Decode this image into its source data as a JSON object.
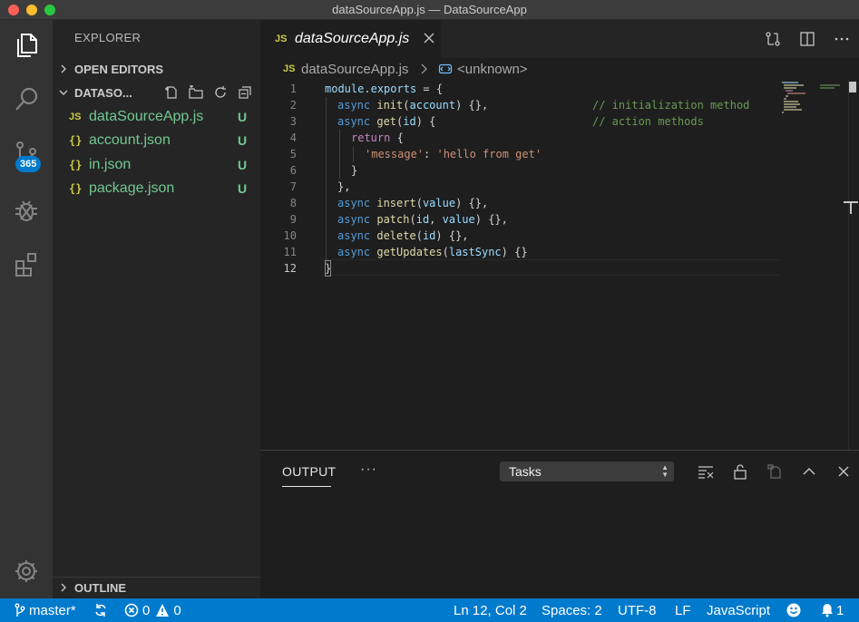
{
  "window": {
    "title": "dataSourceApp.js — DataSourceApp"
  },
  "activity_bar": {
    "items": [
      {
        "name": "explorer",
        "icon": "files-icon"
      },
      {
        "name": "search",
        "icon": "search-icon"
      },
      {
        "name": "source-control",
        "icon": "source-control-icon",
        "badge": "365"
      },
      {
        "name": "debug",
        "icon": "debug-icon"
      },
      {
        "name": "extensions",
        "icon": "extensions-icon"
      },
      {
        "name": "manage",
        "icon": "gear-icon"
      }
    ]
  },
  "sidebar": {
    "title": "EXPLORER",
    "open_editors_label": "OPEN EDITORS",
    "folder_label": "DATASO...",
    "outline_label": "OUTLINE",
    "files": [
      {
        "icon": "JS",
        "name": "dataSourceApp.js",
        "status": "U"
      },
      {
        "icon": "{}",
        "name": "account.json",
        "status": "U"
      },
      {
        "icon": "{}",
        "name": "in.json",
        "status": "U"
      },
      {
        "icon": "{}",
        "name": "package.json",
        "status": "U"
      }
    ]
  },
  "editor": {
    "tab": {
      "icon": "JS",
      "label": "dataSourceApp.js"
    },
    "breadcrumb": {
      "icon": "JS",
      "file": "dataSourceApp.js",
      "symbol": "<unknown>"
    },
    "line_numbers": [
      "1",
      "2",
      "3",
      "4",
      "5",
      "6",
      "7",
      "8",
      "9",
      "10",
      "11",
      "12"
    ],
    "active_line": "12",
    "lines": {
      "l1": {
        "a": "module",
        "b": ".",
        "c": "exports",
        "d": " = {"
      },
      "l2": {
        "a": "async",
        "b": " ",
        "c": "init",
        "d": "(",
        "e": "account",
        "f": ") {},",
        "g": "// initialization method"
      },
      "l3": {
        "a": "async",
        "b": " ",
        "c": "get",
        "d": "(",
        "e": "id",
        "f": ") {",
        "g": "// action methods"
      },
      "l4": {
        "a": "return",
        "b": " {"
      },
      "l5": {
        "a": "'message'",
        "b": ": ",
        "c": "'hello from get'"
      },
      "l6": {
        "a": "}"
      },
      "l7": {
        "a": "},"
      },
      "l8": {
        "a": "async",
        "b": " ",
        "c": "insert",
        "d": "(",
        "e": "value",
        "f": ") {},"
      },
      "l9": {
        "a": "async",
        "b": " ",
        "c": "patch",
        "d": "(",
        "e": "id",
        "f": ", ",
        "g": "value",
        "h": ") {},"
      },
      "l10": {
        "a": "async",
        "b": " ",
        "c": "delete",
        "d": "(",
        "e": "id",
        "f": ") {},"
      },
      "l11": {
        "a": "async",
        "b": " ",
        "c": "getUpdates",
        "d": "(",
        "e": "lastSync",
        "f": ") {}"
      },
      "l12": {
        "a": "}"
      }
    }
  },
  "panel": {
    "tab_label": "OUTPUT",
    "more_label": "···",
    "select_value": "Tasks"
  },
  "statusbar": {
    "branch": "master*",
    "errors": "0",
    "warnings": "0",
    "position": "Ln 12, Col 2",
    "spaces": "Spaces: 2",
    "encoding": "UTF-8",
    "eol": "LF",
    "language": "JavaScript"
  },
  "colors": {
    "accent": "#007acc",
    "untracked": "#73c991",
    "keyword": "#569cd6",
    "function": "#dcdcaa",
    "variable": "#9cdcfe",
    "string": "#ce9178",
    "comment": "#6a9955"
  }
}
